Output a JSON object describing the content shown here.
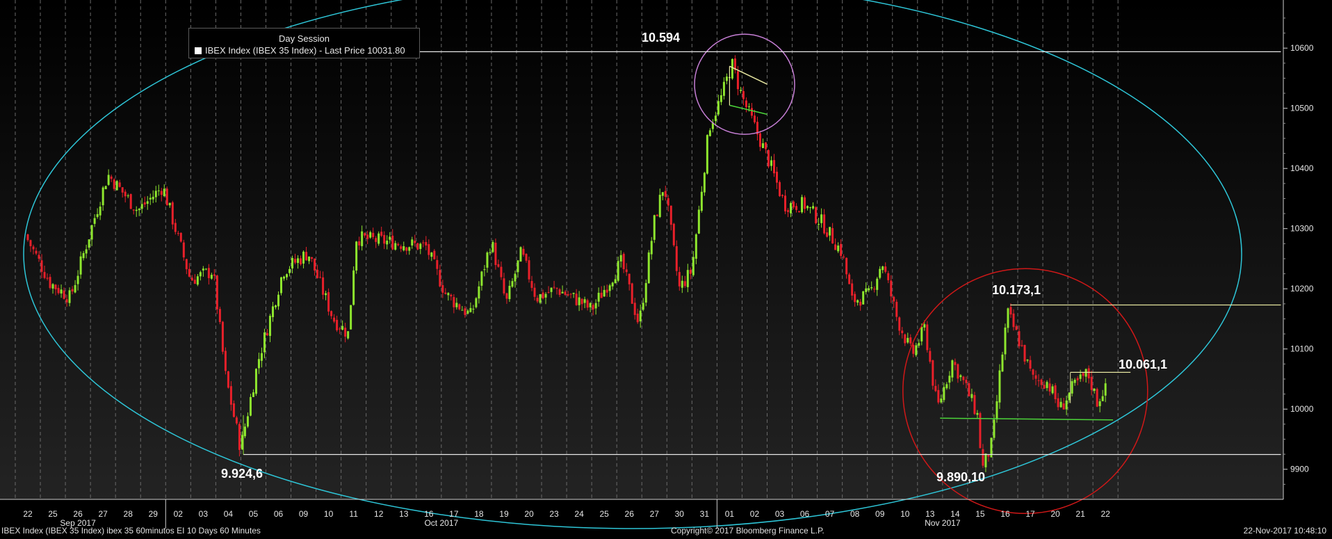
{
  "chart_data": {
    "type": "candlestick",
    "title": "",
    "legend": {
      "header": "Day Session",
      "entry": "IBEX Index (IBEX 35 Index) - Last Price 10031.80",
      "placement": "top-left"
    },
    "y_axis": {
      "side": "right",
      "ylim": [
        9850,
        10680
      ],
      "ticks": [
        {
          "value": 9900,
          "label": "9900"
        },
        {
          "value": 10000,
          "label": "10000"
        },
        {
          "value": 10100,
          "label": "10100"
        },
        {
          "value": 10200,
          "label": "10200"
        },
        {
          "value": 10300,
          "label": "10300"
        },
        {
          "value": 10400,
          "label": "10400"
        },
        {
          "value": 10500,
          "label": "10500"
        },
        {
          "value": 10600,
          "label": "10600"
        }
      ]
    },
    "x_axis": {
      "days": [
        "22",
        "25",
        "26",
        "27",
        "28",
        "29",
        "02",
        "03",
        "04",
        "05",
        "06",
        "09",
        "10",
        "11",
        "12",
        "13",
        "16",
        "17",
        "18",
        "19",
        "20",
        "23",
        "24",
        "25",
        "26",
        "27",
        "30",
        "31",
        "01",
        "02",
        "03",
        "06",
        "07",
        "08",
        "09",
        "10",
        "13",
        "14",
        "15",
        "16",
        "17",
        "20",
        "21",
        "22"
      ],
      "month_labels": [
        {
          "label": "Sep 2017",
          "day_index": 2
        },
        {
          "label": "Oct 2017",
          "day_index": 16.5
        },
        {
          "label": "Nov 2017",
          "day_index": 36.5
        }
      ],
      "month_separators_after": [
        5,
        27
      ]
    },
    "grid": "vertical-dashed",
    "colors": {
      "up": "#8ee62e",
      "down": "#e8202a",
      "cyan_ellipse": "#2ec6d8",
      "purple_circle": "#c77fd6",
      "red_circle": "#d01818",
      "green_line": "#4cd63a",
      "level_line": "#e8e8e8",
      "neckline": "#e6e6a0"
    },
    "anchors": [
      {
        "x": 0,
        "y": 10290
      },
      {
        "x": 1,
        "y": 10210
      },
      {
        "x": 1.8,
        "y": 10185
      },
      {
        "x": 3.3,
        "y": 10390
      },
      {
        "x": 4.5,
        "y": 10330
      },
      {
        "x": 5.5,
        "y": 10370
      },
      {
        "x": 6.6,
        "y": 10215
      },
      {
        "x": 7.5,
        "y": 10230
      },
      {
        "x": 8.0,
        "y": 10055
      },
      {
        "x": 8.6,
        "y": 9935
      },
      {
        "x": 9.3,
        "y": 10080
      },
      {
        "x": 10.3,
        "y": 10230
      },
      {
        "x": 11.3,
        "y": 10260
      },
      {
        "x": 12.3,
        "y": 10150
      },
      {
        "x": 12.9,
        "y": 10125
      },
      {
        "x": 13.2,
        "y": 10285
      },
      {
        "x": 15.1,
        "y": 10275
      },
      {
        "x": 16.0,
        "y": 10270
      },
      {
        "x": 16.8,
        "y": 10190
      },
      {
        "x": 17.8,
        "y": 10155
      },
      {
        "x": 18.6,
        "y": 10280
      },
      {
        "x": 19.2,
        "y": 10175
      },
      {
        "x": 19.8,
        "y": 10260
      },
      {
        "x": 20.4,
        "y": 10185
      },
      {
        "x": 21.2,
        "y": 10200
      },
      {
        "x": 22.1,
        "y": 10180
      },
      {
        "x": 22.6,
        "y": 10165
      },
      {
        "x": 23.8,
        "y": 10245
      },
      {
        "x": 24.5,
        "y": 10140
      },
      {
        "x": 25.1,
        "y": 10310
      },
      {
        "x": 25.5,
        "y": 10375
      },
      {
        "x": 26.1,
        "y": 10200
      },
      {
        "x": 26.6,
        "y": 10230
      },
      {
        "x": 27.3,
        "y": 10470
      },
      {
        "x": 27.8,
        "y": 10520
      },
      {
        "x": 28.2,
        "y": 10575
      },
      {
        "x": 28.6,
        "y": 10520
      },
      {
        "x": 29.2,
        "y": 10460
      },
      {
        "x": 29.7,
        "y": 10410
      },
      {
        "x": 30.3,
        "y": 10340
      },
      {
        "x": 31.1,
        "y": 10340
      },
      {
        "x": 31.8,
        "y": 10310
      },
      {
        "x": 32.6,
        "y": 10260
      },
      {
        "x": 33.0,
        "y": 10180
      },
      {
        "x": 33.7,
        "y": 10190
      },
      {
        "x": 34.2,
        "y": 10245
      },
      {
        "x": 34.8,
        "y": 10150
      },
      {
        "x": 35.4,
        "y": 10090
      },
      {
        "x": 35.9,
        "y": 10135
      },
      {
        "x": 36.4,
        "y": 10000
      },
      {
        "x": 37.0,
        "y": 10080
      },
      {
        "x": 37.5,
        "y": 10040
      },
      {
        "x": 38.0,
        "y": 9990
      },
      {
        "x": 38.2,
        "y": 9900
      },
      {
        "x": 38.6,
        "y": 9945
      },
      {
        "x": 38.9,
        "y": 10060
      },
      {
        "x": 39.2,
        "y": 10160
      },
      {
        "x": 39.7,
        "y": 10110
      },
      {
        "x": 40.2,
        "y": 10050
      },
      {
        "x": 40.8,
        "y": 10045
      },
      {
        "x": 41.3,
        "y": 10000
      },
      {
        "x": 41.8,
        "y": 10035
      },
      {
        "x": 42.4,
        "y": 10060
      },
      {
        "x": 42.8,
        "y": 10010
      },
      {
        "x": 43.0,
        "y": 10031.8
      }
    ],
    "levels": [
      {
        "label": "10.594",
        "value": 10594,
        "from_day": 6.5,
        "to_day": 50
      },
      {
        "label": "9.924,6",
        "value": 9924.6,
        "from_day": 8.6,
        "to_day": 50
      },
      {
        "label": "10.173,1",
        "value": 10173.1,
        "from_day": 39.2,
        "to_day": 50
      },
      {
        "label": "10.061,1",
        "value": 10061.1,
        "from_day": 41.6,
        "to_day": 44.0
      }
    ],
    "low_label": {
      "label": "9.890,10",
      "value": 9890.1
    },
    "trendlines": [
      {
        "kind": "support",
        "from": [
          36.4,
          9985
        ],
        "to": [
          43.3,
          9982
        ]
      },
      {
        "kind": "wedge-top",
        "from": [
          28.0,
          10570
        ],
        "to": [
          29.5,
          10540
        ]
      },
      {
        "kind": "wedge-bottom",
        "from": [
          28.0,
          10505
        ],
        "to": [
          29.5,
          10490
        ]
      }
    ]
  },
  "footer": {
    "left": "IBEX Index (IBEX 35 Index) ibex 35 60minutos EI 10 Days 60 Minutes",
    "center": "Copyright© 2017 Bloomberg Finance L.P.",
    "right": "22-Nov-2017 10:48:10"
  }
}
